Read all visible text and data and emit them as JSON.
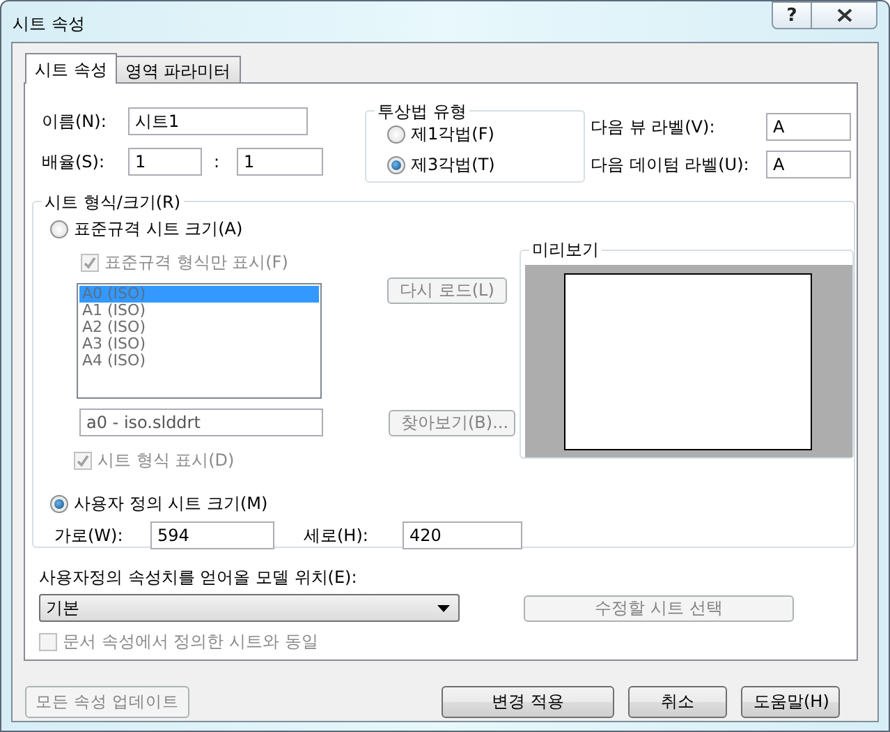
{
  "window": {
    "title": "시트 속성",
    "help_glyph": "?"
  },
  "tabs": [
    {
      "label": "시트 속성",
      "selected": true
    },
    {
      "label": "영역 파라미터",
      "selected": false
    }
  ],
  "name": {
    "label": "이름(N):",
    "value": "시트1"
  },
  "scale": {
    "label": "배율(S):",
    "value_1": "1",
    "separator": ":",
    "value_2": "1"
  },
  "projection": {
    "title": "투상법 유형",
    "options": [
      {
        "label": "제1각법(F)",
        "selected": false
      },
      {
        "label": "제3각법(T)",
        "selected": true
      }
    ]
  },
  "next_view_label": {
    "label": "다음 뷰 라벨(V):",
    "value": "A"
  },
  "next_datum_label": {
    "label": "다음 데이텀 라벨(U):",
    "value": "A"
  },
  "sheet_format": {
    "title": "시트 형식/크기(R)",
    "standard": {
      "label": "표준규격 시트 크기(A)",
      "selected": false
    },
    "standard_only": {
      "label": "표준규격 형식만 표시(F)",
      "checked": true,
      "disabled": true
    },
    "list": {
      "disabled": true,
      "items": [
        {
          "label": "A0 (ISO)",
          "selected": true
        },
        {
          "label": "A1 (ISO)",
          "selected": false
        },
        {
          "label": "A2 (ISO)",
          "selected": false
        },
        {
          "label": "A3 (ISO)",
          "selected": false
        },
        {
          "label": "A4 (ISO)",
          "selected": false
        }
      ]
    },
    "reload_button": {
      "label": "다시 로드(L)",
      "disabled": true
    },
    "template_path": {
      "value": "a0 - iso.slddrt",
      "disabled": true
    },
    "browse_button": {
      "label": "찾아보기(B)...",
      "disabled": true
    },
    "display_format": {
      "label": "시트 형식 표시(D)",
      "checked": true,
      "disabled": true
    },
    "preview": {
      "title": "미리보기"
    },
    "custom": {
      "label": "사용자 정의 시트 크기(M)",
      "selected": true
    },
    "width": {
      "label": "가로(W):",
      "value": "594"
    },
    "height": {
      "label": "세로(H):",
      "value": "420"
    }
  },
  "model_location": {
    "label": "사용자정의 속성치를 얻어올 모델 위치(E):",
    "value": "기본",
    "select_button": {
      "label": "수정할 시트 선택",
      "disabled": true
    },
    "same_as_document": {
      "label": "문서 속성에서 정의한 시트와 동일",
      "checked": false,
      "disabled": true
    }
  },
  "footer": {
    "update_button": {
      "label": "모든 속성 업데이트",
      "disabled": true
    },
    "buttons": [
      {
        "label": "변경 적용",
        "disabled": false
      },
      {
        "label": "취소",
        "disabled": false
      },
      {
        "label": "도움말(H)",
        "disabled": false
      }
    ]
  }
}
